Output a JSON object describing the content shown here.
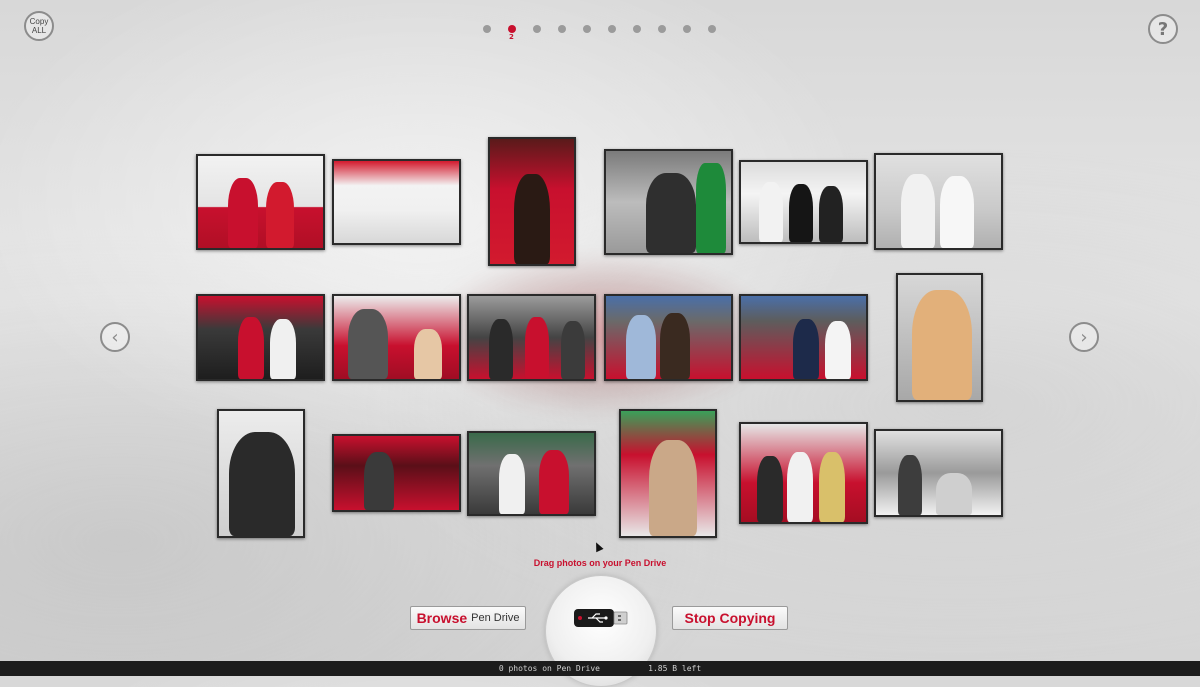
{
  "toolbar": {
    "copy_all_line1": "Copy",
    "copy_all_line2": "ALL",
    "help_label": "?"
  },
  "pager": {
    "total_pages": 10,
    "current_page": 2,
    "current_label": "2"
  },
  "nav": {
    "prev_icon": "chevron-left-icon",
    "next_icon": "chevron-right-icon",
    "prev_glyph": "‹",
    "next_glyph": "›"
  },
  "gallery": {
    "photo_count": 18,
    "photos": [
      {
        "name": "photo-1"
      },
      {
        "name": "photo-2"
      },
      {
        "name": "photo-3"
      },
      {
        "name": "photo-4"
      },
      {
        "name": "photo-5"
      },
      {
        "name": "photo-6"
      },
      {
        "name": "photo-7"
      },
      {
        "name": "photo-8"
      },
      {
        "name": "photo-9"
      },
      {
        "name": "photo-10"
      },
      {
        "name": "photo-11"
      },
      {
        "name": "photo-12"
      },
      {
        "name": "photo-13"
      },
      {
        "name": "photo-14"
      },
      {
        "name": "photo-15"
      },
      {
        "name": "photo-16"
      },
      {
        "name": "photo-17"
      },
      {
        "name": "photo-18"
      }
    ]
  },
  "drive": {
    "hint": "Drag photos on your Pen Drive",
    "icon": "usb-drive-icon"
  },
  "buttons": {
    "browse_main": "Browse",
    "browse_sub": "Pen Drive",
    "stop": "Stop Copying"
  },
  "status": {
    "photos_text": "0 photos on Pen Drive",
    "space_text": "1.85 B left"
  },
  "colors": {
    "accent": "#c8102e",
    "status_bar": "#1c1c1c"
  }
}
